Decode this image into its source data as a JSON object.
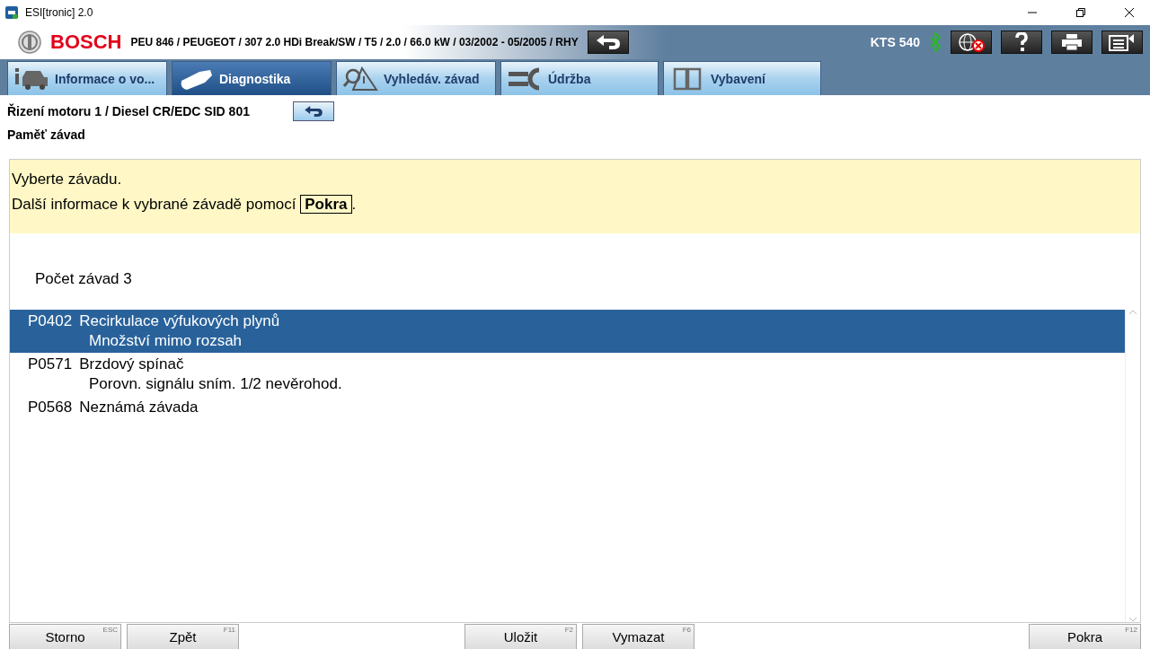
{
  "window": {
    "title": "ESI[tronic] 2.0"
  },
  "header": {
    "brand": "BOSCH",
    "vehicle": "PEU 846 / PEUGEOT / 307 2.0 HDi Break/SW / T5 / 2.0 / 66.0 kW / 03/2002 - 05/2005 / RHY",
    "device": "KTS 540"
  },
  "tabs": [
    {
      "label": "Informace o vo...",
      "kind": "car",
      "selected": false
    },
    {
      "label": "Diagnostika",
      "kind": "plug",
      "selected": true
    },
    {
      "label": "Vyhledáv. závad",
      "kind": "search",
      "selected": false
    },
    {
      "label": "Údržba",
      "kind": "wrench",
      "selected": false
    },
    {
      "label": "Vybavení",
      "kind": "book",
      "selected": false
    }
  ],
  "breadcrumb": {
    "title": "Řizení motoru 1 / Diesel CR/EDC SID 801",
    "subtitle": "Paměť závad"
  },
  "instructions": {
    "line_1": "Vyberte závadu.",
    "line_2": "Další informace k vybrané závadě pomocí",
    "key": "Pokra",
    "end": "."
  },
  "fault_count": "Počet závad 3",
  "faults": [
    {
      "code": "P0402",
      "name": "Recirkulace výfukových plynů",
      "detail": "Množství mimo rozsah",
      "selected": true
    },
    {
      "code": "P0571",
      "name": "Brzdový spínač",
      "detail": "Porovn. signálu sním. 1/2 nevěrohod.",
      "selected": false
    },
    {
      "code": "P0568",
      "name": "Neznámá závada",
      "selected": false
    }
  ],
  "footer_buttons": [
    {
      "label": "Storno",
      "key": "ESC"
    },
    {
      "label": "Zpět",
      "key": "F11"
    },
    {
      "label": "Uložit",
      "key": "F2"
    },
    {
      "label": "Vymazat",
      "key": "F6"
    },
    {
      "label": "Pokra",
      "key": "F12"
    }
  ]
}
